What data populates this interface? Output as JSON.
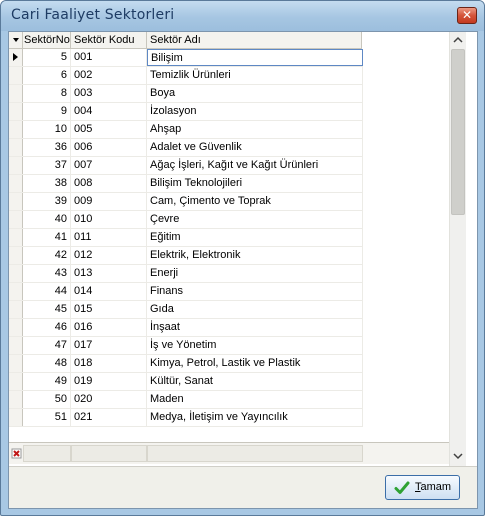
{
  "window": {
    "title": "Cari Faaliyet Sektorleri",
    "close_glyph": "✕"
  },
  "grid": {
    "columns": [
      "SektörNo",
      "Sektör Kodu",
      "Sektör Adı"
    ],
    "rows": [
      {
        "no": "5",
        "kod": "001",
        "ad": "Bilişim"
      },
      {
        "no": "6",
        "kod": "002",
        "ad": "Temizlik Ürünleri"
      },
      {
        "no": "8",
        "kod": "003",
        "ad": "Boya"
      },
      {
        "no": "9",
        "kod": "004",
        "ad": "İzolasyon"
      },
      {
        "no": "10",
        "kod": "005",
        "ad": "Ahşap"
      },
      {
        "no": "36",
        "kod": "006",
        "ad": "Adalet ve Güvenlik"
      },
      {
        "no": "37",
        "kod": "007",
        "ad": "Ağaç İşleri, Kağıt ve Kağıt Ürünleri"
      },
      {
        "no": "38",
        "kod": "008",
        "ad": "Bilişim Teknolojileri"
      },
      {
        "no": "39",
        "kod": "009",
        "ad": "Cam, Çimento ve Toprak"
      },
      {
        "no": "40",
        "kod": "010",
        "ad": "Çevre"
      },
      {
        "no": "41",
        "kod": "011",
        "ad": "Eğitim"
      },
      {
        "no": "42",
        "kod": "012",
        "ad": "Elektrik, Elektronik"
      },
      {
        "no": "43",
        "kod": "013",
        "ad": "Enerji"
      },
      {
        "no": "44",
        "kod": "014",
        "ad": "Finans"
      },
      {
        "no": "45",
        "kod": "015",
        "ad": "Gıda"
      },
      {
        "no": "46",
        "kod": "016",
        "ad": "İnşaat"
      },
      {
        "no": "47",
        "kod": "017",
        "ad": "İş ve Yönetim"
      },
      {
        "no": "48",
        "kod": "018",
        "ad": "Kimya, Petrol, Lastik ve Plastik"
      },
      {
        "no": "49",
        "kod": "019",
        "ad": "Kültür, Sanat"
      },
      {
        "no": "50",
        "kod": "020",
        "ad": "Maden"
      },
      {
        "no": "51",
        "kod": "021",
        "ad": "Medya, İletişim ve Yayıncılık"
      }
    ],
    "selected_row_index": 0
  },
  "buttons": {
    "ok_mnemonic": "T",
    "ok_rest": "amam"
  },
  "icons": {
    "close": "close-icon",
    "ok": "checkmark-icon",
    "scroll_up": "chevron-up-icon",
    "scroll_down": "chevron-down-icon",
    "row_pointer": "current-row-arrow-icon",
    "footer_indicator": "insert-row-indicator-icon"
  },
  "colors": {
    "title_bar": "#a8c8e4",
    "close_button": "#d4543a",
    "grid_header": "#f4f3ef",
    "selection_border": "#5e88c4",
    "ok_check": "#2fa233"
  }
}
